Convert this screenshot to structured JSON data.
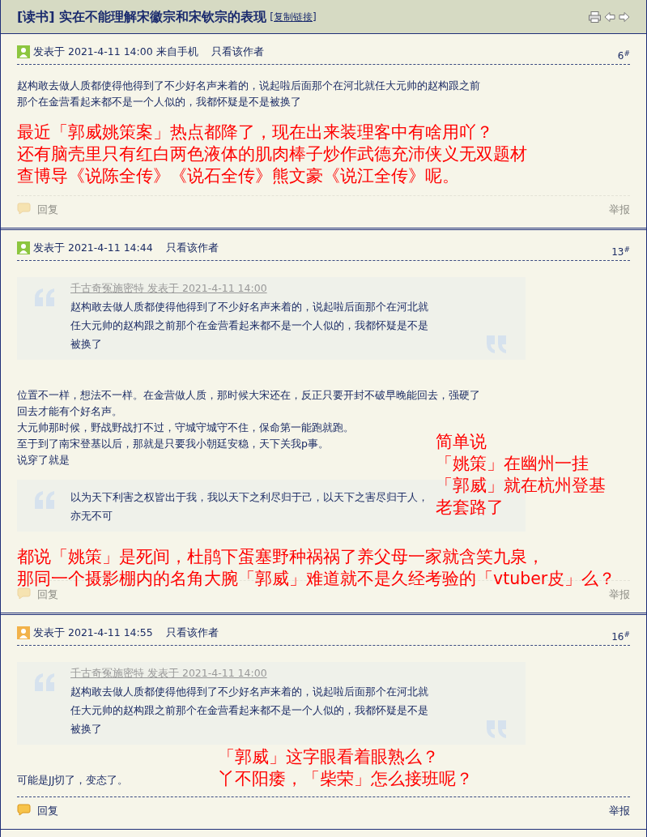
{
  "thread": {
    "title": "[读书] 实在不能理解宋徽宗和宋钦宗的表现",
    "copy_link": "[复制链接]"
  },
  "posts": [
    {
      "color": "#8cc63f",
      "meta": "发表于 2021-4-11 14:00 来自手机",
      "author_only": "只看该作者",
      "floor": "6$^{#}$",
      "blocks": [
        {
          "kind": "text",
          "lines": [
            "赵构敢去做人质都使得他得到了不少好名声来着的，说起啦后面那个在河北就任大元帅的赵构跟之前",
            "那个在金营看起来都不是一个人似的，我都怀疑是不是被换了"
          ]
        }
      ],
      "annotations": [
        {
          "kind": "inline",
          "lines": [
            "最近「郭威姚策案」热点都降了，现在出来装理客中有啥用吖？",
            "还有脑壳里只有红白两色液体的肌肉棒子炒作武德充沛侠义无双题材",
            "查博导《说陈全传》《说石全传》熊文豪《说江全传》呢。"
          ]
        }
      ],
      "footer": {
        "reply": "回复",
        "report": "举报",
        "dimmed": true
      }
    },
    {
      "color": "#8cc63f",
      "meta": "发表于 2021-4-11 14:44",
      "author_only": "只看该作者",
      "floor": "13$^{#}$",
      "blocks": [
        {
          "kind": "quote",
          "source": "千古奇冤施密特 发表于 2021-4-11 14:00",
          "lines": [
            "赵构敢去做人质都使得他得到了不少好名声来着的，说起啦后面那个在河北就",
            "任大元帅的赵构跟之前那个在金营看起来都不是一个人似的，我都怀疑是不是",
            "被换了"
          ]
        },
        {
          "kind": "text",
          "lines": [
            "位置不一样，想法不一样。在金营做人质，那时候大宋还在，反正只要开封不破早晚能回去，强硬了",
            "回去才能有个好名声。",
            "大元帅那时候，野战野战打不过，守城守城守不住，保命第一能跑就跑。",
            "至于到了南宋登基以后，那就是只要我小朝廷安稳，天下关我p事。",
            "说穿了就是"
          ]
        },
        {
          "kind": "quote",
          "lines": [
            "以为天下利害之权皆出于我，我以天下之利尽归于己，以天下之害尽归于人，",
            "亦无不可"
          ]
        }
      ],
      "annotations": [
        {
          "kind": "aside",
          "lines": [
            "简单说",
            "「姚策」在幽州一挂",
            "「郭威」就在杭州登基",
            "老套路了"
          ]
        },
        {
          "kind": "inline",
          "lines": [
            "都说「姚策」是死间，杜鹃下蛋塞野种祸祸了养父母一家就含笑九泉，",
            "那同一个摄影棚内的名角大腕「郭威」难道就不是久经考验的「vtuber皮」么？"
          ]
        }
      ],
      "footer": {
        "reply": "回复",
        "report": "举报",
        "dimmed": true
      }
    },
    {
      "color": "#f2b24a",
      "meta": "发表于 2021-4-11 14:55",
      "author_only": "只看该作者",
      "floor": "16$^{#}$",
      "blocks": [
        {
          "kind": "quote",
          "source": "千古奇冤施密特 发表于 2021-4-11 14:00",
          "lines": [
            "赵构敢去做人质都使得他得到了不少好名声来着的，说起啦后面那个在河北就",
            "任大元帅的赵构跟之前那个在金营看起来都不是一个人似的，我都怀疑是不是",
            "被换了"
          ]
        },
        {
          "kind": "text",
          "lines": [
            "可能是JJ切了，变态了。"
          ]
        }
      ],
      "annotations": [
        {
          "kind": "aside",
          "lines": [
            "「郭威」这字眼看着眼熟么？",
            "丫不阳痿，「柴荣」怎么接班呢？"
          ]
        }
      ],
      "footer": {
        "reply": "回复",
        "report": "举报",
        "dimmed": false
      }
    }
  ]
}
